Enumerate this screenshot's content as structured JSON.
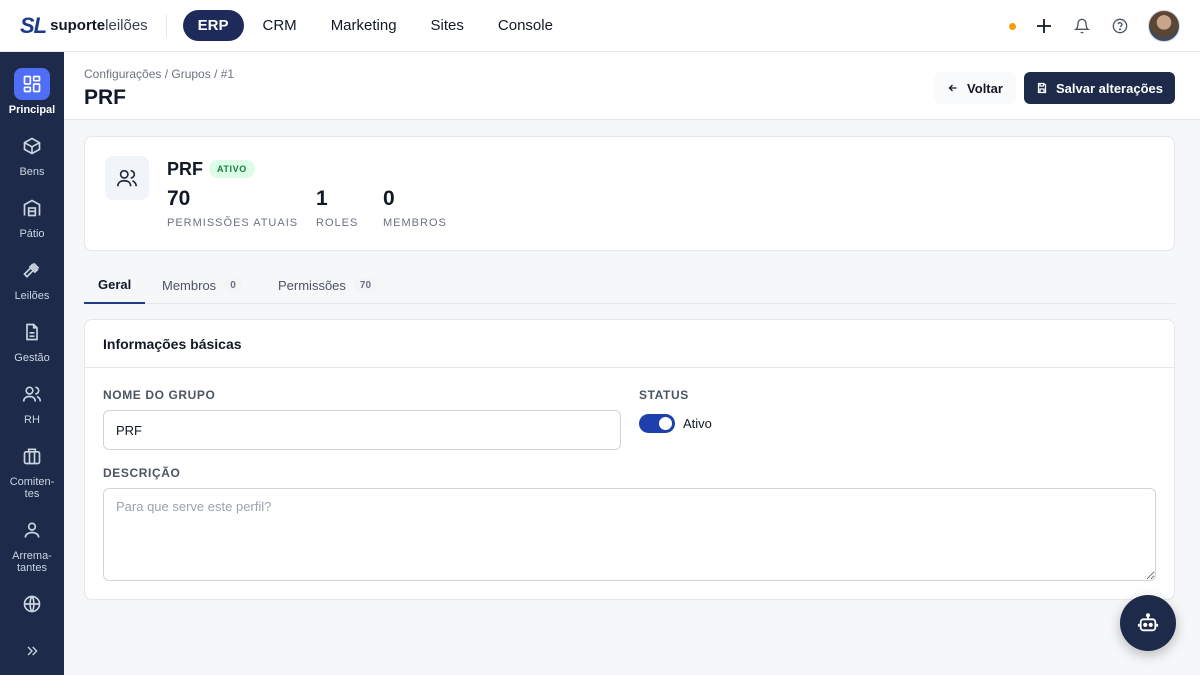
{
  "brand": {
    "mark": "SL",
    "name_bold": "suporte",
    "name_light": "leilões"
  },
  "topnav": [
    {
      "label": "ERP",
      "active": true
    },
    {
      "label": "CRM"
    },
    {
      "label": "Marketing"
    },
    {
      "label": "Sites"
    },
    {
      "label": "Console"
    }
  ],
  "sidebar": {
    "items": [
      {
        "label": "Principal",
        "icon": "grid-icon",
        "active": true
      },
      {
        "label": "Bens",
        "icon": "box-icon"
      },
      {
        "label": "Pátio",
        "icon": "warehouse-icon"
      },
      {
        "label": "Leilões",
        "icon": "gavel-icon"
      },
      {
        "label": "Gestão",
        "icon": "document-icon"
      },
      {
        "label": "RH",
        "icon": "users-icon"
      },
      {
        "label": "Comiten-\ntes",
        "icon": "briefcase-icon"
      },
      {
        "label": "Arrema-\ntantes",
        "icon": "user-icon"
      },
      {
        "label": "",
        "icon": "globe-icon"
      }
    ]
  },
  "header": {
    "breadcrumb": "Configurações / Grupos / #1",
    "title": "PRF",
    "back_label": "Voltar",
    "save_label": "Salvar alterações"
  },
  "summary": {
    "name": "PRF",
    "badge": "ATIVO",
    "stats": [
      {
        "value": "70",
        "label": "PERMISSÕES ATUAIS"
      },
      {
        "value": "1",
        "label": "ROLES"
      },
      {
        "value": "0",
        "label": "MEMBROS"
      }
    ]
  },
  "tabs": [
    {
      "label": "Geral",
      "active": true
    },
    {
      "label": "Membros",
      "count": "0"
    },
    {
      "label": "Permissões",
      "count": "70"
    }
  ],
  "form": {
    "section_title": "Informações básicas",
    "name_label": "NOME DO GRUPO",
    "name_value": "PRF",
    "status_label": "STATUS",
    "status_value": "Ativo",
    "status_on": true,
    "description_label": "DESCRIÇÃO",
    "description_placeholder": "Para que serve este perfil?",
    "description_value": ""
  },
  "colors": {
    "accent": "#1e2a4a",
    "active_nav": "#4f6ef7",
    "success": "#15803d",
    "notify": "#f59e0b"
  }
}
